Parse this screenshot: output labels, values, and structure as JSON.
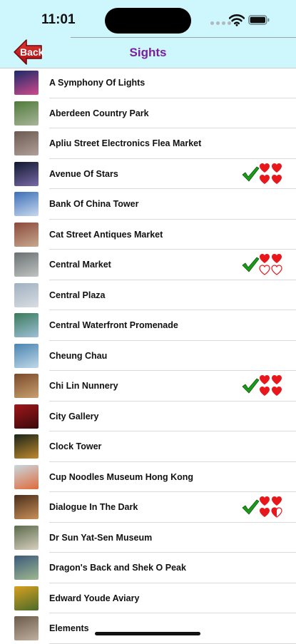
{
  "status_bar": {
    "time": "11:01"
  },
  "nav": {
    "back_label": "Back",
    "title": "Sights"
  },
  "colors": {
    "bar_background": "#cdf6fd",
    "title": "#7a1f9e",
    "back_button": "#c0181e",
    "check": "#1d9a1b",
    "heart": "#e8171b"
  },
  "sights": [
    {
      "name": "A Symphony Of Lights",
      "thumb_colors": [
        "#1a2a6a",
        "#d04a8a"
      ]
    },
    {
      "name": "Aberdeen Country Park",
      "thumb_colors": [
        "#4f7a3a",
        "#a9b59a"
      ]
    },
    {
      "name": "Apliu Street Electronics Flea Market",
      "thumb_colors": [
        "#6a5a52",
        "#b0a098"
      ]
    },
    {
      "name": "Avenue Of Stars",
      "thumb_colors": [
        "#10182e",
        "#7a6aa8"
      ],
      "visited": true,
      "rating": 4,
      "max_rating": 4
    },
    {
      "name": "Bank Of China Tower",
      "thumb_colors": [
        "#3c6fb6",
        "#c8d8ee"
      ]
    },
    {
      "name": "Cat Street Antiques Market",
      "thumb_colors": [
        "#8a4a3a",
        "#c8a890"
      ]
    },
    {
      "name": "Central Market",
      "thumb_colors": [
        "#6a7072",
        "#c0c4c2"
      ],
      "visited": true,
      "rating": 2,
      "max_rating": 4
    },
    {
      "name": "Central Plaza",
      "thumb_colors": [
        "#a0b0c0",
        "#d8dde2"
      ]
    },
    {
      "name": "Central Waterfront Promenade",
      "thumb_colors": [
        "#3a7a5a",
        "#9fc0d8"
      ]
    },
    {
      "name": "Cheung Chau",
      "thumb_colors": [
        "#4a84b0",
        "#c0d8e8"
      ]
    },
    {
      "name": "Chi Lin Nunnery",
      "thumb_colors": [
        "#7a4a2a",
        "#c8a070"
      ],
      "visited": true,
      "rating": 4,
      "max_rating": 4
    },
    {
      "name": "City Gallery",
      "thumb_colors": [
        "#a0161a",
        "#3a0a0c"
      ]
    },
    {
      "name": "Clock Tower",
      "thumb_colors": [
        "#1a2418",
        "#c08a30"
      ]
    },
    {
      "name": "Cup Noodles Museum Hong Kong",
      "thumb_colors": [
        "#c8d8e0",
        "#e06a3a"
      ]
    },
    {
      "name": "Dialogue In The Dark",
      "thumb_colors": [
        "#4a2e1c",
        "#c89058"
      ],
      "visited": true,
      "rating": 3.5,
      "max_rating": 4
    },
    {
      "name": "Dr Sun Yat-Sen Museum",
      "thumb_colors": [
        "#5a6a4a",
        "#d8d0c0"
      ]
    },
    {
      "name": "Dragon's Back and Shek O Peak",
      "thumb_colors": [
        "#3a5a7a",
        "#a0b890"
      ]
    },
    {
      "name": "Edward Youde Aviary",
      "thumb_colors": [
        "#d8a020",
        "#4a6a2a"
      ]
    },
    {
      "name": "Elements",
      "thumb_colors": [
        "#6a5a4a",
        "#c0b0a0"
      ]
    }
  ]
}
